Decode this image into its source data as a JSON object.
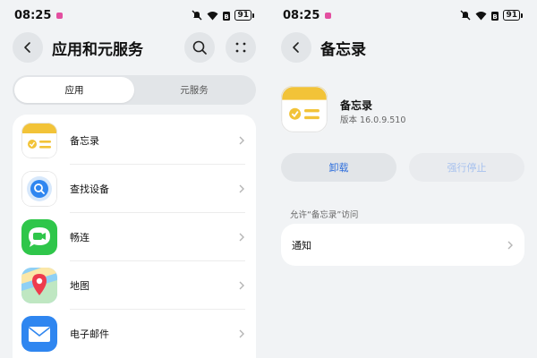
{
  "status_bar": {
    "time": "08:25",
    "battery": "91"
  },
  "list_screen": {
    "title": "应用和元服务",
    "tabs": [
      {
        "label": "应用",
        "active": true
      },
      {
        "label": "元服务",
        "active": false
      }
    ],
    "apps": [
      {
        "name": "备忘录",
        "icon": "notepad-icon"
      },
      {
        "name": "查找设备",
        "icon": "find-device-icon"
      },
      {
        "name": "畅连",
        "icon": "meetime-icon"
      },
      {
        "name": "地图",
        "icon": "map-pin-icon"
      },
      {
        "name": "电子邮件",
        "icon": "mail-icon"
      }
    ]
  },
  "detail_screen": {
    "title": "备忘录",
    "app_name": "备忘录",
    "version": "版本 16.0.9.510",
    "uninstall_label": "卸载",
    "force_stop_label": "强行停止",
    "permission_section": "允许“备忘录”访问",
    "permissions": [
      {
        "label": "通知"
      }
    ]
  },
  "colors": {
    "accent_blue": "#2f6fdc",
    "notepad_yellow": "#f2c338",
    "meetime_green": "#2fc64a",
    "mail_blue": "#2f86f0",
    "background": "#f1f3f5"
  }
}
